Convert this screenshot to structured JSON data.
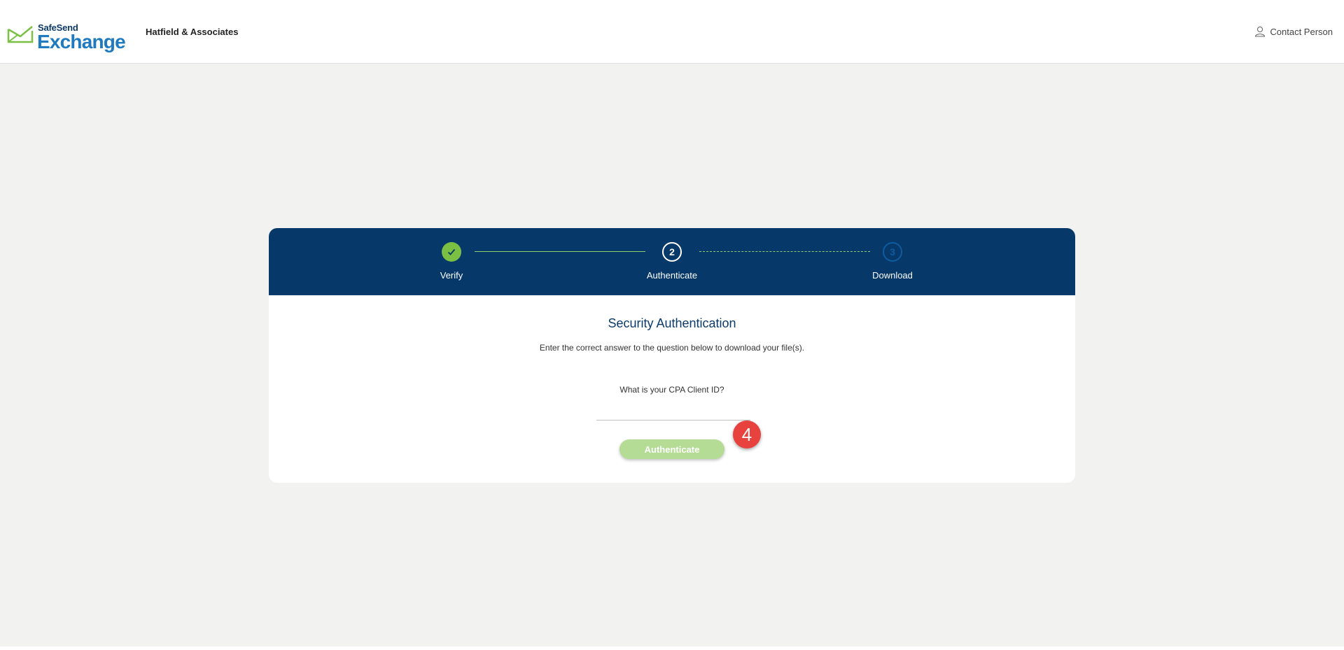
{
  "header": {
    "logo_top": "SafeSend",
    "logo_bottom": "Exchange",
    "company": "Hatfield & Associates",
    "contact": "Contact Person"
  },
  "steps": [
    {
      "label": "Verify",
      "number": "1",
      "state": "done"
    },
    {
      "label": "Authenticate",
      "number": "2",
      "state": "current"
    },
    {
      "label": "Download",
      "number": "3",
      "state": "future"
    }
  ],
  "auth": {
    "title": "Security Authentication",
    "subtitle": "Enter the correct answer to the question below to download your file(s).",
    "question": "What is your CPA Client ID?",
    "answer_value": "",
    "button_label": "Authenticate"
  },
  "marker": {
    "label": "4"
  },
  "colors": {
    "brand_navy": "#06386a",
    "brand_green": "#7bc043",
    "button_disabled": "#b5dc95",
    "marker_red": "#e8423f"
  }
}
